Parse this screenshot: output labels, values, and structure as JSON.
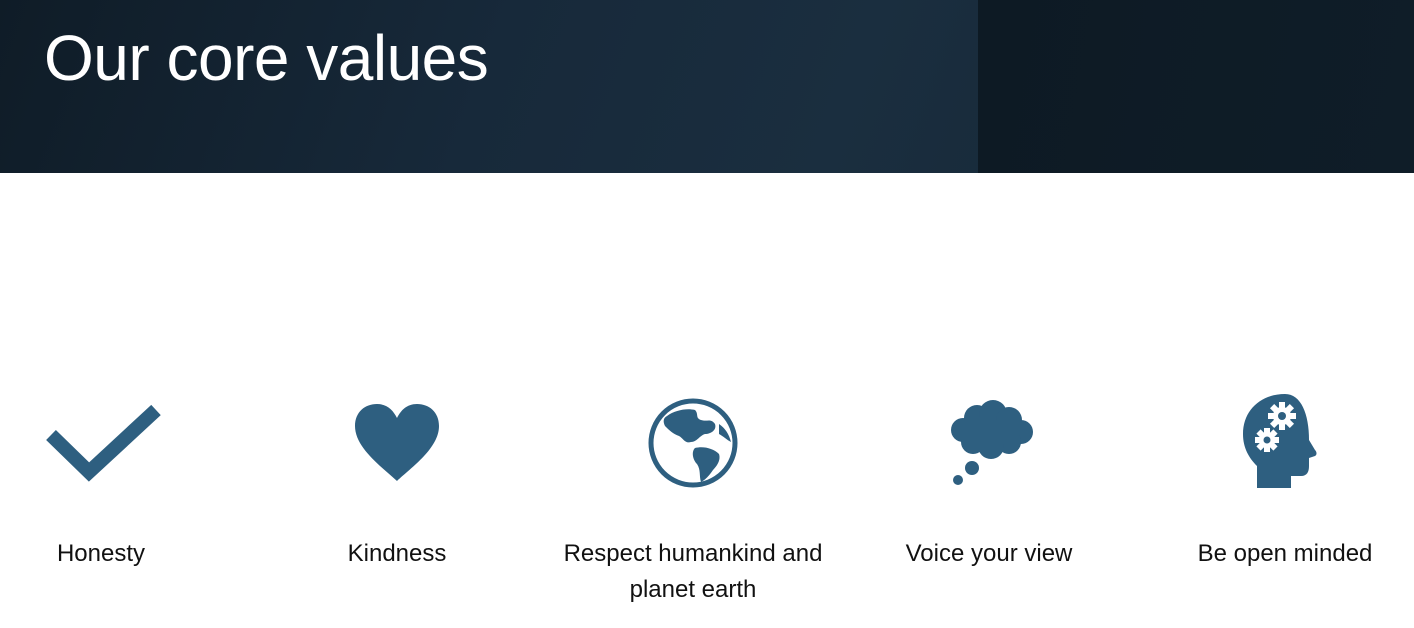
{
  "header": {
    "title": "Our core values",
    "background_color": "#17293a"
  },
  "values": [
    {
      "label": "Honesty",
      "icon": "checkmark-icon"
    },
    {
      "label": "Kindness",
      "icon": "heart-icon"
    },
    {
      "label": "Respect humankind and planet earth",
      "icon": "globe-icon"
    },
    {
      "label": "Voice your view",
      "icon": "thought-bubble-icon"
    },
    {
      "label": "Be open minded",
      "icon": "head-gears-icon"
    }
  ],
  "colors": {
    "icon": "#2e5f80",
    "text": "#111111"
  }
}
